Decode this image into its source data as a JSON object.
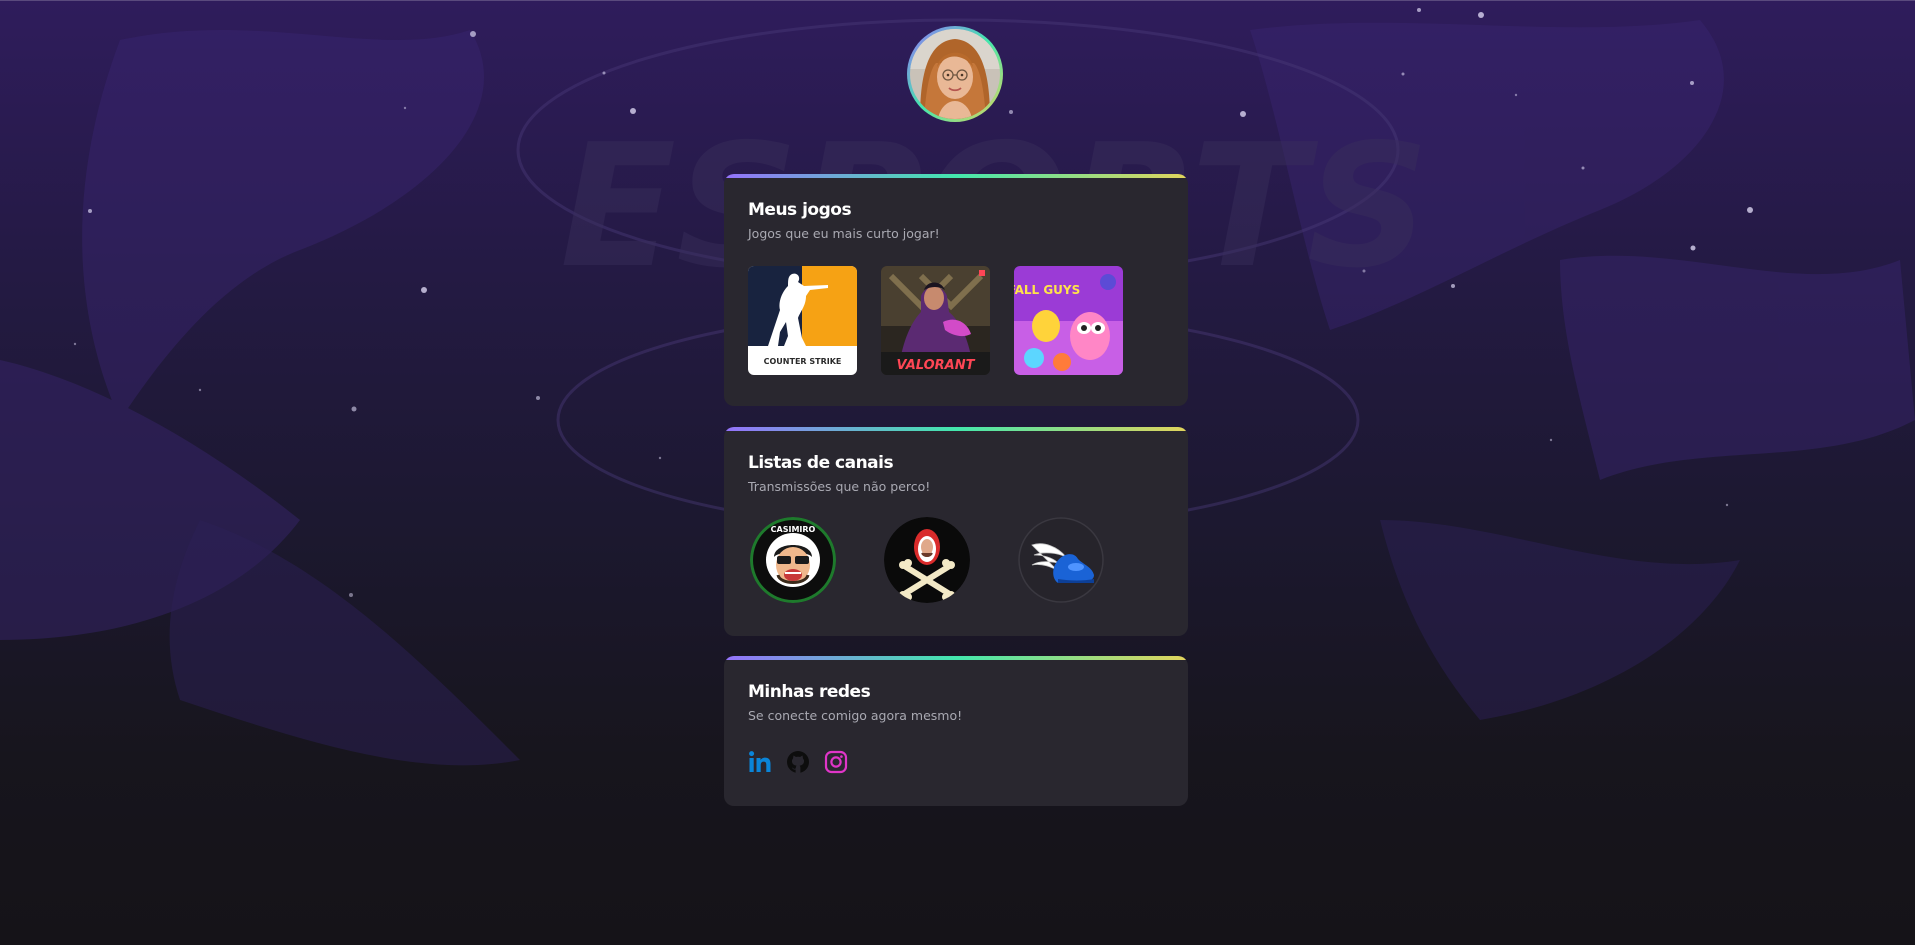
{
  "profile": {
    "avatar_icon": "profile-photo-icon",
    "ring_gradient": [
      "#9572fc",
      "#43e7ad",
      "#e2d45c"
    ]
  },
  "sections": {
    "games": {
      "title": "Meus jogos",
      "subtitle": "Jogos que eu mais curto jogar!",
      "items": [
        {
          "name": "Counter Strike",
          "logo_text": "COUNTER STRIKE",
          "icon": "counter-strike-logo-icon"
        },
        {
          "name": "Valorant",
          "logo_text": "VALORANT",
          "icon": "valorant-cover-icon"
        },
        {
          "name": "Fall Guys",
          "logo_text": "FALL GUYS",
          "icon": "fall-guys-cover-icon"
        }
      ]
    },
    "channels": {
      "title": "Listas de canais",
      "subtitle": "Transmissões que não perco!",
      "items": [
        {
          "name": "Casimiro",
          "logo_text": "CASIMIRO",
          "icon": "casimiro-logo-icon"
        },
        {
          "name": "Skull channel",
          "icon": "skull-crossbones-logo-icon"
        },
        {
          "name": "Winged shoe channel",
          "icon": "winged-shoe-logo-icon"
        }
      ]
    },
    "socials": {
      "title": "Minhas redes",
      "subtitle": "Se conecte comigo agora mesmo!",
      "items": [
        {
          "name": "LinkedIn",
          "icon": "linkedin-icon",
          "color": "#0a85d9"
        },
        {
          "name": "GitHub",
          "icon": "github-icon",
          "color": "#0d0d0d"
        },
        {
          "name": "Instagram",
          "icon": "instagram-icon",
          "color": "#e035c8"
        }
      ]
    }
  },
  "colors": {
    "card_bg": "#29272f",
    "title": "#ffffff",
    "subtitle": "#a9a9b2",
    "accent_gradient": [
      "#9572fc",
      "#43e7ad",
      "#e2d45c"
    ]
  }
}
